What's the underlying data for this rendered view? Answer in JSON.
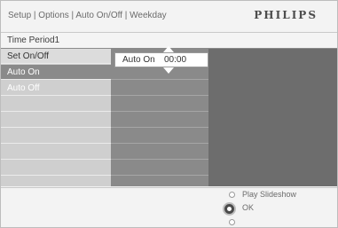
{
  "header": {
    "breadcrumb": "Setup | Options | Auto On/Off | Weekday",
    "brand": "PHILIPS"
  },
  "panel": {
    "title": "Time Period1",
    "menu_items": [
      {
        "label": "Set On/Off",
        "state": "normal"
      },
      {
        "label": "Auto On",
        "state": "selected"
      },
      {
        "label": "Auto Off",
        "state": "disabled"
      }
    ]
  },
  "value_editor": {
    "label": "Auto On",
    "value": "00:00"
  },
  "footer": {
    "hint_primary": "Play Slideshow",
    "hint_secondary": "OK"
  },
  "colors": {
    "selected_row": "#8a8a8a",
    "dark_area": "#6d6d6d",
    "brand_text": "#4d4d4d"
  }
}
